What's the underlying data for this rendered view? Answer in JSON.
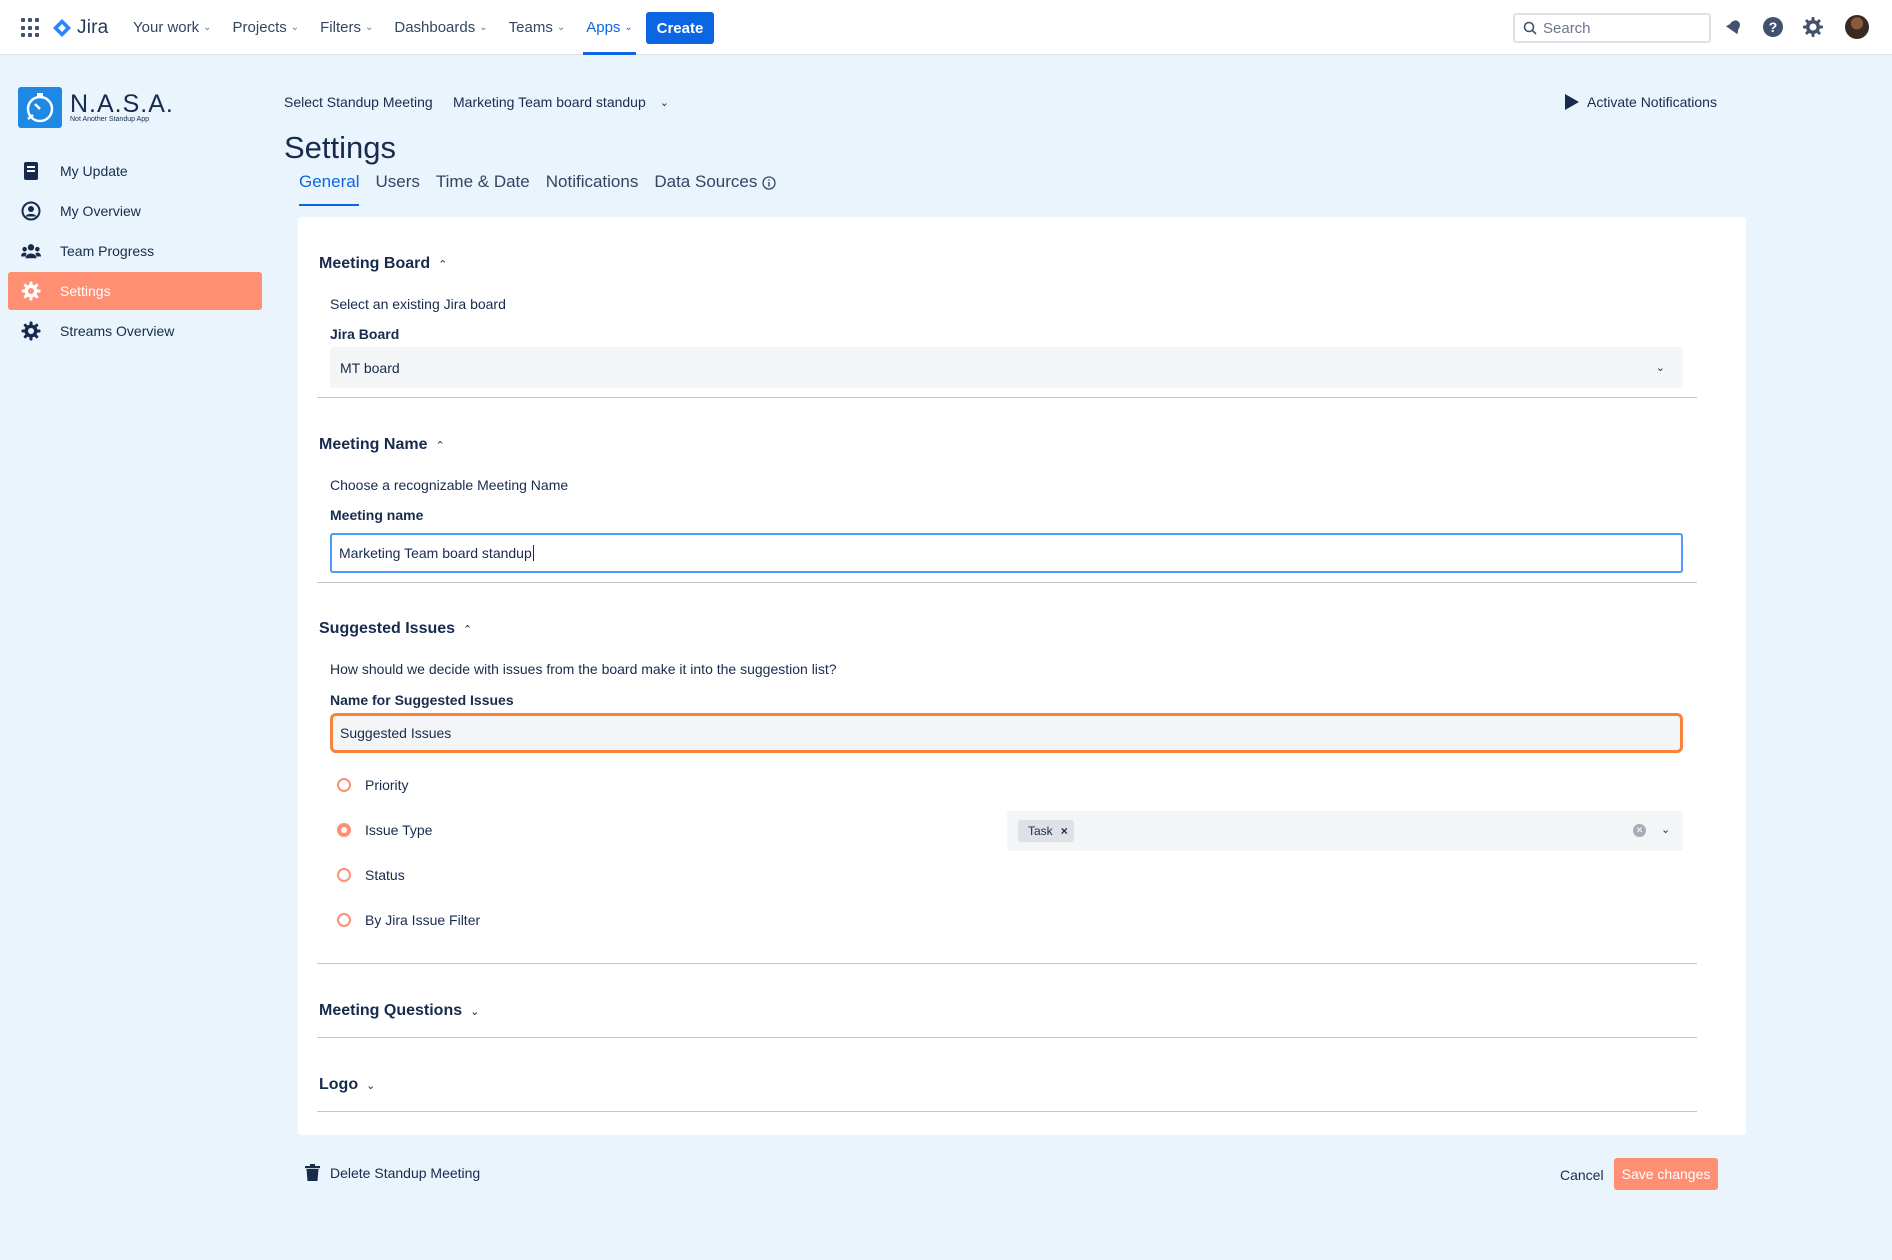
{
  "topnav": {
    "app_name": "Jira",
    "menu": [
      {
        "label": "Your work"
      },
      {
        "label": "Projects"
      },
      {
        "label": "Filters"
      },
      {
        "label": "Dashboards"
      },
      {
        "label": "Teams"
      },
      {
        "label": "Apps"
      }
    ],
    "create_label": "Create",
    "search_placeholder": "Search"
  },
  "sidebar": {
    "logo_title": "N.A.S.A.",
    "logo_subtitle": "Not Another Standup App",
    "items": [
      {
        "label": "My Update",
        "icon": "document-icon"
      },
      {
        "label": "My Overview",
        "icon": "user-circle-icon"
      },
      {
        "label": "Team Progress",
        "icon": "people-icon"
      },
      {
        "label": "Settings",
        "icon": "gear-icon"
      },
      {
        "label": "Streams Overview",
        "icon": "gear-icon"
      }
    ],
    "active_item": "Settings"
  },
  "header": {
    "select_label": "Select Standup Meeting",
    "selected_meeting": "Marketing Team board standup",
    "activate_label": "Activate Notifications",
    "page_title": "Settings",
    "tabs": [
      {
        "label": "General"
      },
      {
        "label": "Users"
      },
      {
        "label": "Time & Date"
      },
      {
        "label": "Notifications"
      },
      {
        "label": "Data Sources"
      }
    ],
    "active_tab": "General"
  },
  "sections": {
    "meeting_board": {
      "title": "Meeting Board",
      "description": "Select an existing Jira board",
      "field_label": "Jira Board",
      "value": "MT board"
    },
    "meeting_name": {
      "title": "Meeting Name",
      "description": "Choose a recognizable Meeting Name",
      "field_label": "Meeting name",
      "value": "Marketing Team board standup"
    },
    "suggested_issues": {
      "title": "Suggested Issues",
      "description": "How should we decide with issues from the board make it into the suggestion list?",
      "field_label": "Name for Suggested Issues",
      "value": "Suggested Issues",
      "options": [
        {
          "label": "Priority"
        },
        {
          "label": "Issue Type"
        },
        {
          "label": "Status"
        },
        {
          "label": "By Jira Issue Filter"
        }
      ],
      "selected_option": "Issue Type",
      "issue_type_tags": [
        "Task"
      ]
    },
    "meeting_questions": {
      "title": "Meeting Questions"
    },
    "logo": {
      "title": "Logo"
    }
  },
  "footer": {
    "delete_label": "Delete Standup Meeting",
    "cancel_label": "Cancel",
    "save_label": "Save changes"
  },
  "colors": {
    "accent": "#FF8F73",
    "primary": "#0C66E4",
    "focus_border": "#F7833B",
    "background": "#EAF4FC"
  }
}
